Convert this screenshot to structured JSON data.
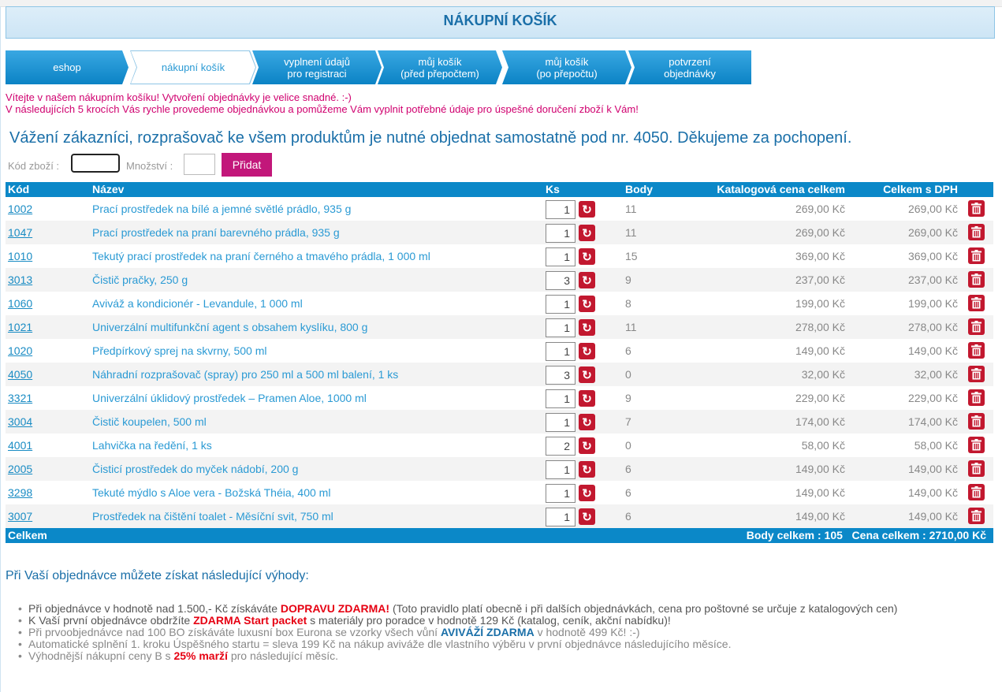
{
  "header": {
    "title": "NÁKUPNÍ KOŠÍK"
  },
  "steps": [
    {
      "line1": "eshop",
      "line2": ""
    },
    {
      "line1": "nákupní košík",
      "line2": ""
    },
    {
      "line1": "vyplnení údajů",
      "line2": "pro registraci"
    },
    {
      "line1": "můj košík",
      "line2": "(před přepočtem)"
    },
    {
      "line1": "můj košík",
      "line2": "(po přepočtu)"
    },
    {
      "line1": "potvrzení",
      "line2": "objednávky"
    }
  ],
  "welcome": {
    "line1": "Vítejte v našem nákupním košíku! Vytvoření objednávky je velice snadné. :-)",
    "line2": "V následujících 5 krocích Vás rychle provedeme objednávkou a pomůžeme Vám vyplnit potřebné údaje pro úspešné doručení zboží k Vám!"
  },
  "notice": "Vážení zákazníci, rozprašovač ke všem produktům je nutné objednat samostatně pod nr. 4050. Děkujeme za pochopení.",
  "add_form": {
    "code_label": "Kód zboží :",
    "qty_label": "Množství :",
    "code_value": "",
    "qty_value": "",
    "button": "Přidat"
  },
  "table": {
    "headers": {
      "code": "Kód",
      "name": "Název",
      "qty": "Ks",
      "points": "Body",
      "catalog": "Katalogová cena celkem",
      "total": "Celkem s DPH"
    },
    "rows": [
      {
        "code": "1002",
        "name": "Prací prostředek na bílé a jemné světlé prádlo, 935 g",
        "qty": "1",
        "points": "11",
        "catalog": "269,00 Kč",
        "total": "269,00 Kč"
      },
      {
        "code": "1047",
        "name": "Prací prostředek na praní barevného prádla, 935 g",
        "qty": "1",
        "points": "11",
        "catalog": "269,00 Kč",
        "total": "269,00 Kč"
      },
      {
        "code": "1010",
        "name": "Tekutý prací prostředek na praní černého a tmavého prádla, 1 000 ml",
        "qty": "1",
        "points": "15",
        "catalog": "369,00 Kč",
        "total": "369,00 Kč"
      },
      {
        "code": "3013",
        "name": "Čistič pračky, 250 g",
        "qty": "3",
        "points": "9",
        "catalog": "237,00 Kč",
        "total": "237,00 Kč"
      },
      {
        "code": "1060",
        "name": "Aviváž a kondicionér - Levandule, 1 000 ml",
        "qty": "1",
        "points": "8",
        "catalog": "199,00 Kč",
        "total": "199,00 Kč"
      },
      {
        "code": "1021",
        "name": "Univerzální multifunkční agent s obsahem kyslíku, 800 g",
        "qty": "1",
        "points": "11",
        "catalog": "278,00 Kč",
        "total": "278,00 Kč"
      },
      {
        "code": "1020",
        "name": "Předpírkový sprej na skvrny, 500 ml",
        "qty": "1",
        "points": "6",
        "catalog": "149,00 Kč",
        "total": "149,00 Kč"
      },
      {
        "code": "4050",
        "name": "Náhradní rozprašovač (spray) pro 250 ml a 500 ml balení, 1 ks",
        "qty": "3",
        "points": "0",
        "catalog": "32,00 Kč",
        "total": "32,00 Kč"
      },
      {
        "code": "3321",
        "name": "Univerzální úklidový prostředek – Pramen Aloe, 1000 ml",
        "qty": "1",
        "points": "9",
        "catalog": "229,00 Kč",
        "total": "229,00 Kč"
      },
      {
        "code": "3004",
        "name": "Čistič koupelen, 500 ml",
        "qty": "1",
        "points": "7",
        "catalog": "174,00 Kč",
        "total": "174,00 Kč"
      },
      {
        "code": "4001",
        "name": "Lahvička na ředění, 1 ks",
        "qty": "2",
        "points": "0",
        "catalog": "58,00 Kč",
        "total": "58,00 Kč"
      },
      {
        "code": "2005",
        "name": "Čisticí prostředek do myček nádobí, 200 g",
        "qty": "1",
        "points": "6",
        "catalog": "149,00 Kč",
        "total": "149,00 Kč"
      },
      {
        "code": "3298",
        "name": "Tekuté mýdlo s Aloe vera - Božská Théia, 400 ml",
        "qty": "1",
        "points": "6",
        "catalog": "149,00 Kč",
        "total": "149,00 Kč"
      },
      {
        "code": "3007",
        "name": "Prostředek na čištění toalet - Měsíční svit, 750 ml",
        "qty": "1",
        "points": "6",
        "catalog": "149,00 Kč",
        "total": "149,00 Kč"
      }
    ],
    "footer": {
      "label": "Celkem",
      "summary": "Body celkem : 105   Cena celkem : 2710,00 Kč"
    }
  },
  "benefits": {
    "title": "Při Vaší objednávce můžete získat následující výhody:",
    "b1": {
      "pre": "Při objednávce v hodnotě nad 1.500,- Kč získáváte ",
      "hl": "DOPRAVU ZDARMA!",
      "post": " (Toto pravidlo platí obecně i při dalších objednávkách, cena pro poštovné se určuje z katalogových cen)"
    },
    "b2": {
      "pre": "K Vaší první objednávce obdržíte ",
      "hl": "ZDARMA Start packet",
      "post": " s materiály pro poradce v hodnotě 129 Kč (katalog, ceník, akční nabídku)!"
    },
    "b3": {
      "pre": "Při prvoobjednávce nad 100 BO získáváte luxusní box Eurona se vzorky všech vůní ",
      "hl": "AVIVÁŽÍ ZDARMA",
      "post": " v hodnotě 499 Kč! :-)"
    },
    "b4": "Automatické splnění 1. kroku Úspěšného startu = sleva 199 Kč na nákup aviváže dle vlastního výběru v první objednávce následujícího měsíce.",
    "b5": {
      "pre": "Výhodnější nákupní ceny B s ",
      "hl": "25% marží",
      "post": " pro následující měsíc."
    }
  },
  "colors": {
    "accent": "#0b88c8",
    "magenta": "#c2177a",
    "danger": "#c2182f"
  },
  "icons": {
    "refresh": "refresh-icon",
    "delete": "trash-icon"
  }
}
